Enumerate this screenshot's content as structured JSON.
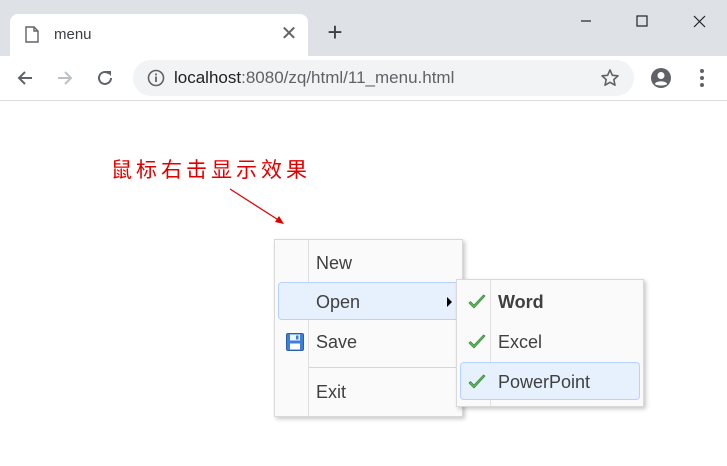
{
  "browser": {
    "tab_title": "menu",
    "url_host": "localhost",
    "url_rest": ":8080/zq/html/11_menu.html",
    "icons": [
      "page-icon",
      "close-icon",
      "plus-icon",
      "minimize-icon",
      "maximize-icon",
      "window-close-icon",
      "back-icon",
      "forward-icon",
      "reload-icon",
      "info-icon",
      "star-icon",
      "profile-icon",
      "more-icon"
    ]
  },
  "page": {
    "annotation": "鼠标右击显示效果",
    "annotation_color": "#e00000"
  },
  "context_menu": {
    "items": [
      {
        "label": "New"
      },
      {
        "label": "Open",
        "has_submenu": true,
        "highlighted": true
      },
      {
        "label": "Save",
        "icon": "save-icon"
      },
      {
        "label": "Exit"
      }
    ]
  },
  "open_submenu": {
    "items": [
      {
        "label": "Word",
        "icon": "check-icon",
        "bold": true
      },
      {
        "label": "Excel",
        "icon": "check-icon"
      },
      {
        "label": "PowerPoint",
        "icon": "check-icon",
        "highlighted": true
      }
    ]
  },
  "colors": {
    "highlight_bg": "#e7f0fd",
    "highlight_border": "#b7d2ff",
    "check_green": "#4caf50"
  }
}
